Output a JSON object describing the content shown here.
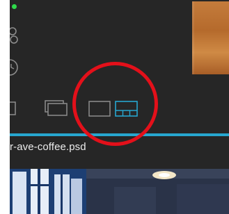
{
  "status": {
    "indicator_color": "#2ed94a"
  },
  "toolbar": {
    "buttons": [
      {
        "name": "single-view",
        "icon": "single-frame-icon",
        "selected": false
      },
      {
        "name": "compare-view",
        "icon": "stacked-frames-icon",
        "selected": false
      },
      {
        "name": "layout-single",
        "icon": "single-panel-layout-icon",
        "selected": false
      },
      {
        "name": "layout-filmstrip",
        "icon": "panel-with-filmstrip-layout-icon",
        "selected": true
      }
    ],
    "accent_color": "#27a6cf"
  },
  "document": {
    "filename": "r-ave-coffee.psd"
  },
  "annotation": {
    "color": "#e3101a",
    "shape": "circle"
  }
}
